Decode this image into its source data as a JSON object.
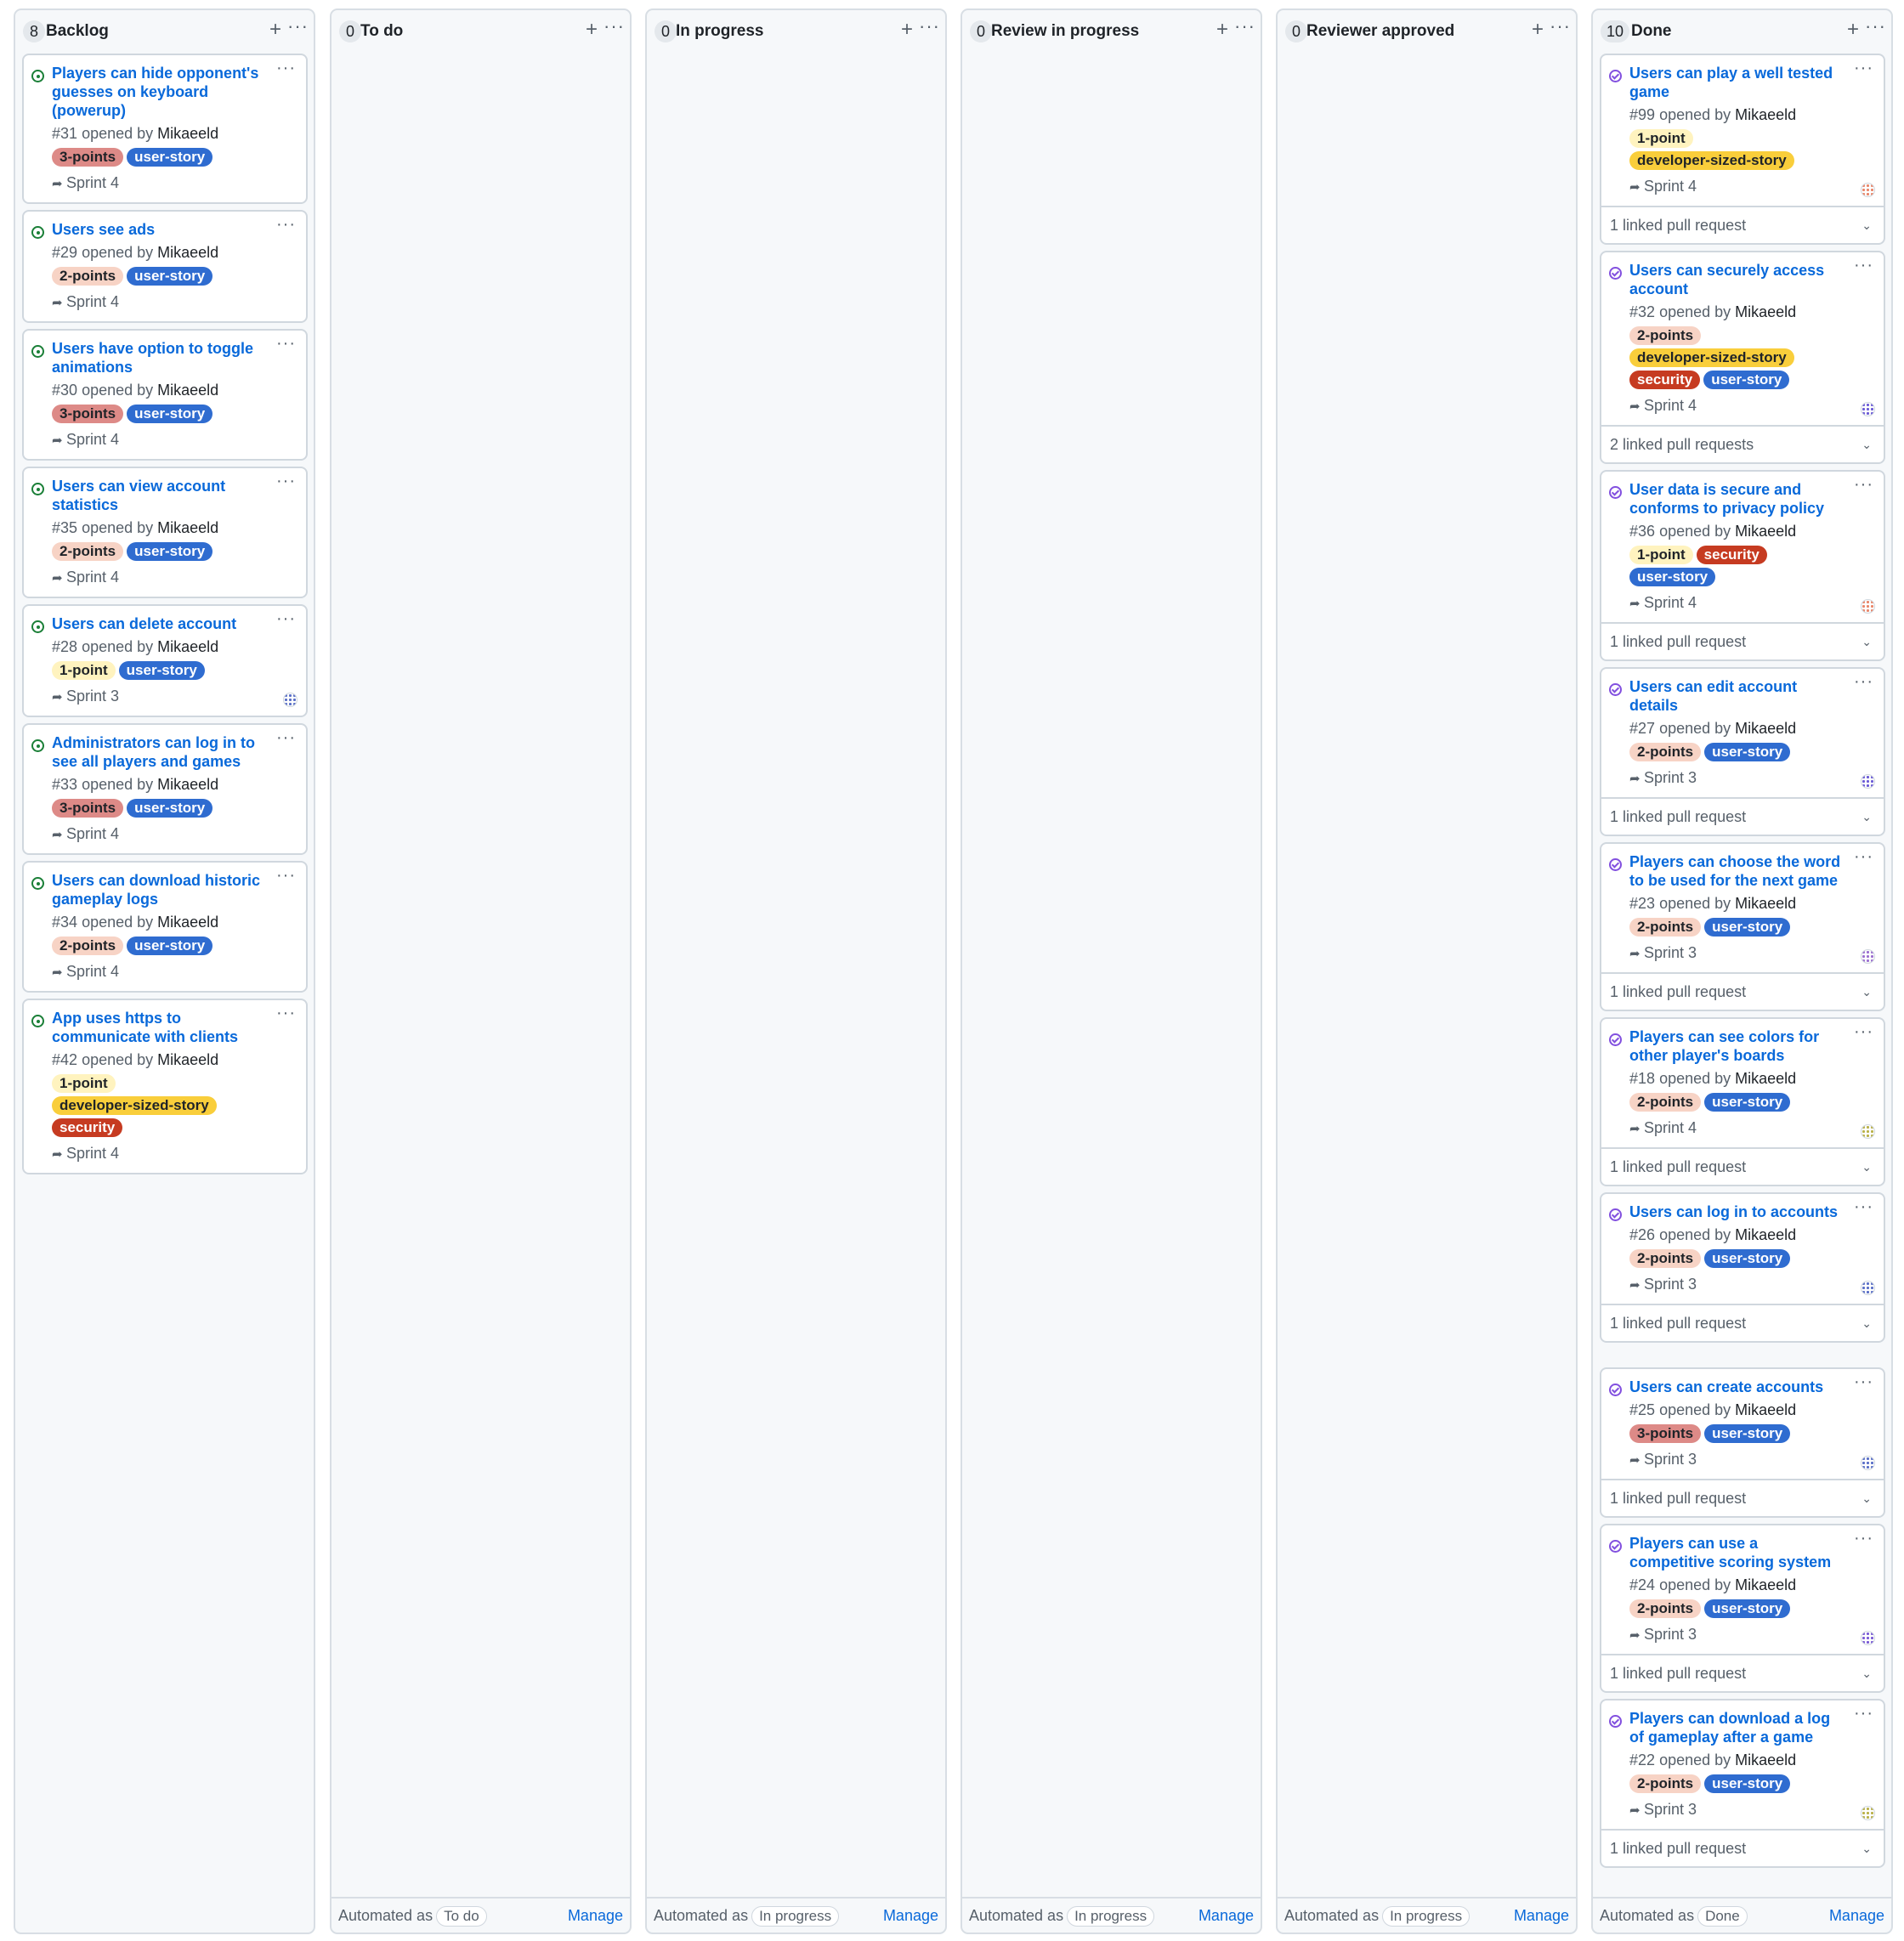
{
  "label_colors": {
    "1-point": {
      "bg": "#fff3bf",
      "fg": "#1f2328"
    },
    "2-points": {
      "bg": "#f7d3c5",
      "fg": "#1f2328"
    },
    "3-points": {
      "bg": "#dd8a87",
      "fg": "#1f2328"
    },
    "user-story": {
      "bg": "#2f6cd0",
      "fg": "#ffffff"
    },
    "developer-sized-story": {
      "bg": "#f9ce3b",
      "fg": "#1f2328"
    },
    "security": {
      "bg": "#c63b21",
      "fg": "#ffffff"
    }
  },
  "columns": [
    {
      "count": "8",
      "title": "Backlog",
      "icon": "open",
      "footer": null,
      "cards": [
        {
          "title": "Players can hide opponent's guesses on keyboard (powerup)",
          "number": "#31",
          "opened_by": "opened by",
          "author": "Mikaeeld",
          "labels": [
            "3-points",
            "user-story"
          ],
          "sprint": "Sprint 4",
          "assignee": null,
          "linked_prs": null
        },
        {
          "title": "Users see ads",
          "number": "#29",
          "opened_by": "opened by",
          "author": "Mikaeeld",
          "labels": [
            "2-points",
            "user-story"
          ],
          "sprint": "Sprint 4",
          "assignee": null,
          "linked_prs": null
        },
        {
          "title": "Users have option to toggle animations",
          "number": "#30",
          "opened_by": "opened by",
          "author": "Mikaeeld",
          "labels": [
            "3-points",
            "user-story"
          ],
          "sprint": "Sprint 4",
          "assignee": null,
          "linked_prs": null
        },
        {
          "title": "Users can view account statistics",
          "number": "#35",
          "opened_by": "opened by",
          "author": "Mikaeeld",
          "labels": [
            "2-points",
            "user-story"
          ],
          "sprint": "Sprint 4",
          "assignee": null,
          "linked_prs": null
        },
        {
          "title": "Users can delete account",
          "number": "#28",
          "opened_by": "opened by",
          "author": "Mikaeeld",
          "labels": [
            "1-point",
            "user-story"
          ],
          "sprint": "Sprint 3",
          "assignee": "#5a6fc7",
          "linked_prs": null
        },
        {
          "title": "Administrators can log in to see all players and games",
          "number": "#33",
          "opened_by": "opened by",
          "author": "Mikaeeld",
          "labels": [
            "3-points",
            "user-story"
          ],
          "sprint": "Sprint 4",
          "assignee": null,
          "linked_prs": null
        },
        {
          "title": "Users can download historic gameplay logs",
          "number": "#34",
          "opened_by": "opened by",
          "author": "Mikaeeld",
          "labels": [
            "2-points",
            "user-story"
          ],
          "sprint": "Sprint 4",
          "assignee": null,
          "linked_prs": null
        },
        {
          "title": "App uses https to communicate with clients",
          "number": "#42",
          "opened_by": "opened by",
          "author": "Mikaeeld",
          "labels": [
            "1-point",
            "developer-sized-story",
            "security"
          ],
          "sprint": "Sprint 4",
          "assignee": null,
          "linked_prs": null
        }
      ]
    },
    {
      "count": "0",
      "title": "To do",
      "icon": "open",
      "footer": {
        "prefix": "Automated as",
        "value": "To do",
        "manage": "Manage"
      },
      "cards": []
    },
    {
      "count": "0",
      "title": "In progress",
      "icon": "open",
      "footer": {
        "prefix": "Automated as",
        "value": "In progress",
        "manage": "Manage"
      },
      "cards": []
    },
    {
      "count": "0",
      "title": "Review in progress",
      "icon": "open",
      "footer": {
        "prefix": "Automated as",
        "value": "In progress",
        "manage": "Manage"
      },
      "cards": []
    },
    {
      "count": "0",
      "title": "Reviewer approved",
      "icon": "open",
      "footer": {
        "prefix": "Automated as",
        "value": "In progress",
        "manage": "Manage"
      },
      "cards": []
    },
    {
      "count": "10",
      "title": "Done",
      "icon": "done",
      "footer": {
        "prefix": "Automated as",
        "value": "Done",
        "manage": "Manage"
      },
      "cards": [
        {
          "title": "Users can play a well tested game",
          "number": "#99",
          "opened_by": "opened by",
          "author": "Mikaeeld",
          "labels": [
            "1-point",
            "developer-sized-story"
          ],
          "sprint": "Sprint 4",
          "assignee": "#e8866a",
          "linked_prs": "1 linked pull request"
        },
        {
          "title": "Users can securely access account",
          "number": "#32",
          "opened_by": "opened by",
          "author": "Mikaeeld",
          "labels": [
            "2-points",
            "developer-sized-story",
            "security",
            "user-story"
          ],
          "sprint": "Sprint 4",
          "assignee": "#6b5bd6",
          "linked_prs": "2 linked pull requests"
        },
        {
          "title": "User data is secure and conforms to privacy policy",
          "number": "#36",
          "opened_by": "opened by",
          "author": "Mikaeeld",
          "labels": [
            "1-point",
            "security",
            "user-story"
          ],
          "sprint": "Sprint 4",
          "assignee": "#e8866a",
          "linked_prs": "1 linked pull request"
        },
        {
          "title": "Users can edit account details",
          "number": "#27",
          "opened_by": "opened by",
          "author": "Mikaeeld",
          "labels": [
            "2-points",
            "user-story"
          ],
          "sprint": "Sprint 3",
          "assignee": "#6b5bd6",
          "linked_prs": "1 linked pull request"
        },
        {
          "title": "Players can choose the word to be used for the next game",
          "number": "#23",
          "opened_by": "opened by",
          "author": "Mikaeeld",
          "labels": [
            "2-points",
            "user-story"
          ],
          "sprint": "Sprint 3",
          "assignee": "#9b6fd0",
          "linked_prs": "1 linked pull request"
        },
        {
          "title": "Players can see colors for other player's boards",
          "number": "#18",
          "opened_by": "opened by",
          "author": "Mikaeeld",
          "labels": [
            "2-points",
            "user-story"
          ],
          "sprint": "Sprint 4",
          "assignee": "#b9b14a",
          "linked_prs": "1 linked pull request"
        },
        {
          "title": "Users can log in to accounts",
          "number": "#26",
          "opened_by": "opened by",
          "author": "Mikaeeld",
          "labels": [
            "2-points",
            "user-story"
          ],
          "sprint": "Sprint 3",
          "assignee": "#5a6fc7",
          "linked_prs": "1 linked pull request"
        },
        {
          "title": "Users can create accounts",
          "number": "#25",
          "opened_by": "opened by",
          "author": "Mikaeeld",
          "labels": [
            "3-points",
            "user-story"
          ],
          "sprint": "Sprint 3",
          "assignee": "#5a6fc7",
          "linked_prs": "1 linked pull request"
        },
        {
          "title": "Players can use a competitive scoring system",
          "number": "#24",
          "opened_by": "opened by",
          "author": "Mikaeeld",
          "labels": [
            "2-points",
            "user-story"
          ],
          "sprint": "Sprint 3",
          "assignee": "#7a5bd6",
          "linked_prs": "1 linked pull request"
        },
        {
          "title": "Players can download a log of gameplay after a game",
          "number": "#22",
          "opened_by": "opened by",
          "author": "Mikaeeld",
          "labels": [
            "2-points",
            "user-story"
          ],
          "sprint": "Sprint 3",
          "assignee": "#b9b14a",
          "linked_prs": "1 linked pull request"
        }
      ]
    }
  ]
}
